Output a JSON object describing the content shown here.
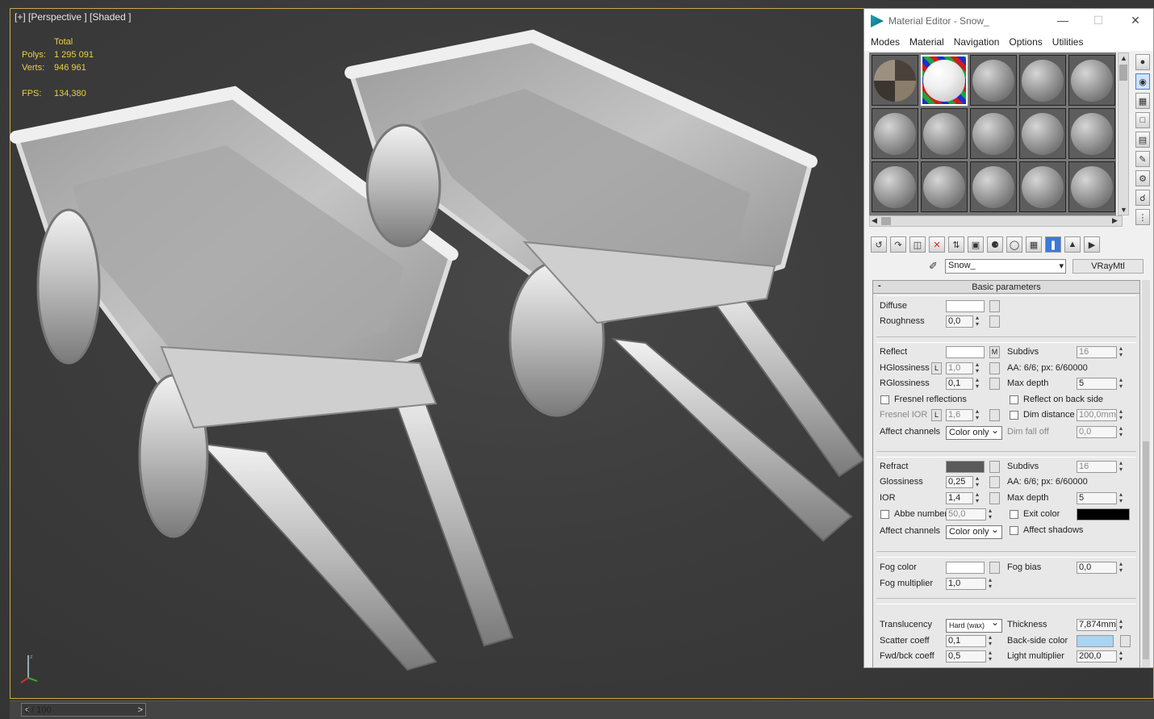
{
  "viewport": {
    "label": "[+] [Perspective ] [Shaded ]",
    "stats_header": "Total",
    "polys_label": "Polys:",
    "polys_value": "1 295 091",
    "verts_label": "Verts:",
    "verts_value": "946 961",
    "fps_label": "FPS:",
    "fps_value": "134,380"
  },
  "timeline": {
    "frame_label": "0 / 100",
    "prev": "<",
    "next": ">"
  },
  "material_editor": {
    "title": "Material Editor - Snow_",
    "window_buttons": {
      "minimize": "—",
      "maximize": "☐",
      "close": "✕"
    },
    "menu": [
      "Modes",
      "Material",
      "Navigation",
      "Options",
      "Utilities"
    ],
    "material_name": "Snow_",
    "material_type": "VRayMtl",
    "rollout_title": "Basic parameters",
    "rollout_toggle": "-",
    "diffuse": {
      "label": "Diffuse",
      "color": "#ffffff",
      "roughness_label": "Roughness",
      "roughness": "0,0"
    },
    "reflect": {
      "label": "Reflect",
      "color": "#ffffff",
      "map_btn": "M",
      "hgloss_label": "HGlossiness",
      "hgloss": "1,0",
      "lock": "L",
      "rgloss_label": "RGlossiness",
      "rgloss": "0,1",
      "fresnel_label": "Fresnel reflections",
      "fresnel_ior_label": "Fresnel IOR",
      "fresnel_ior": "1,6",
      "affect_label": "Affect channels",
      "affect": "Color only",
      "subdivs_label": "Subdivs",
      "subdivs": "16",
      "aa": "AA: 6/6; px: 6/60000",
      "maxdepth_label": "Max depth",
      "maxdepth": "5",
      "backside_label": "Reflect on back side",
      "dimdist_label": "Dim distance",
      "dimdist": "100,0mm",
      "dimfall_label": "Dim fall off",
      "dimfall": "0,0"
    },
    "refract": {
      "label": "Refract",
      "color": "#5a5a5a",
      "gloss_label": "Glossiness",
      "gloss": "0,25",
      "ior_label": "IOR",
      "ior": "1,4",
      "abbe_label": "Abbe number",
      "abbe": "50,0",
      "affect_label": "Affect channels",
      "affect": "Color only",
      "subdivs_label": "Subdivs",
      "subdivs": "16",
      "aa": "AA: 6/6; px: 6/60000",
      "maxdepth_label": "Max depth",
      "maxdepth": "5",
      "exit_label": "Exit color",
      "exit_color": "#000000",
      "shadows_label": "Affect shadows"
    },
    "fog": {
      "color_label": "Fog color",
      "color": "#ffffff",
      "mult_label": "Fog multiplier",
      "mult": "1,0",
      "bias_label": "Fog bias",
      "bias": "0,0"
    },
    "translucency": {
      "label": "Translucency",
      "value": "Hard (wax)",
      "scatter_label": "Scatter coeff",
      "scatter": "0,1",
      "fwd_label": "Fwd/bck coeff",
      "fwd": "0,5",
      "thick_label": "Thickness",
      "thick": "7,874mm",
      "back_label": "Back-side color",
      "back_color": "#a9d4f2",
      "light_label": "Light multiplier",
      "light": "200,0"
    }
  }
}
